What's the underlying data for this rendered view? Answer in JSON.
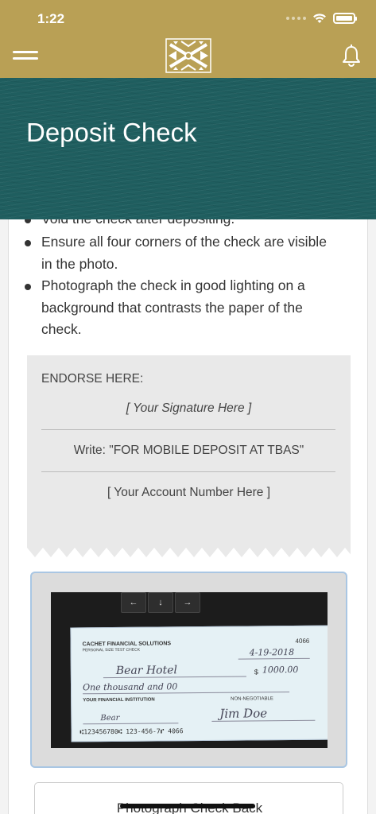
{
  "status_bar": {
    "time": "1:22"
  },
  "header": {
    "logo": "tbas-logo",
    "menu_icon": "hamburger-menu-icon",
    "bell_icon": "bell-icon"
  },
  "banner": {
    "title": "Deposit Check"
  },
  "instructions": {
    "partial_first": "Void the check after depositing.",
    "bullets": [
      {
        "line1": "Ensure all four corners of the check are visible",
        "line2": "in the photo."
      },
      {
        "line1": "Photograph the check in good lighting on a",
        "line2": "background that contrasts the paper of the",
        "line3": "check."
      }
    ]
  },
  "endorse": {
    "label": "ENDORSE HERE:",
    "signature": "[ Your Signature Here ]",
    "write": "Write: \"FOR MOBILE DEPOSIT AT TBAS\"",
    "account": "[ Your Account Number Here ]"
  },
  "check_photo": {
    "company": "CACHET FINANCIAL SOLUTIONS",
    "company_sub": "PERSONAL SIZE TEST CHECK",
    "check_number": "4066",
    "date": "4-19-2018",
    "payee": "Bear Hotel",
    "amount": "1000.00",
    "amount_words": "One thousand and 00",
    "bank": "YOUR FINANCIAL INSTITUTION",
    "non_negotiable": "NON-NEGOTIABLE",
    "memo": "Bear",
    "signature": "Jim Doe",
    "micr": "⑆123456780⑆ 123-456-7⑈ 4066",
    "keys": [
      "←",
      "↓",
      "→"
    ]
  },
  "buttons": {
    "photograph_back": "Photograph Check Back"
  },
  "colors": {
    "header": "#b9a055",
    "banner": "#1f5e5f",
    "photo_border": "#a9c6e3"
  }
}
